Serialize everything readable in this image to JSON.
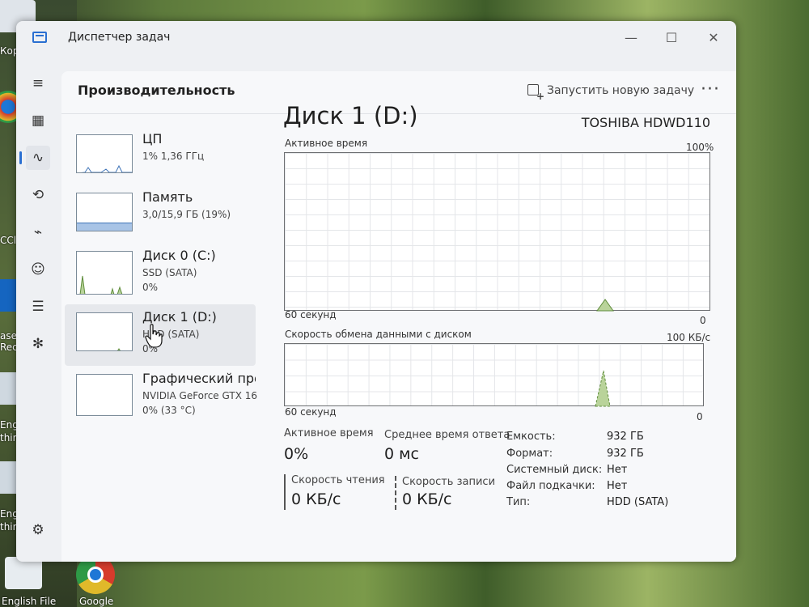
{
  "desktop": {
    "icons": [
      {
        "label": "Кор"
      },
      {
        "label": "CCl"
      },
      {
        "label": "asel"
      },
      {
        "label": "Reco"
      },
      {
        "label": "Engli"
      },
      {
        "label": "third"
      },
      {
        "label": "Engli"
      },
      {
        "label": "third"
      },
      {
        "label": "English File"
      },
      {
        "label": "Google"
      }
    ]
  },
  "window": {
    "title": "Диспетчер задач",
    "controls": {
      "minimize": "—",
      "maximize": "☐",
      "close": "✕"
    }
  },
  "nav": {
    "items": [
      {
        "icon": "hamburger-icon",
        "glyph": "≡"
      },
      {
        "icon": "processes-icon",
        "glyph": "▦"
      },
      {
        "icon": "performance-icon",
        "glyph": "∿"
      },
      {
        "icon": "history-icon",
        "glyph": "⟲"
      },
      {
        "icon": "startup-icon",
        "glyph": "⌁"
      },
      {
        "icon": "users-icon",
        "glyph": "☺"
      },
      {
        "icon": "details-icon",
        "glyph": "☰"
      },
      {
        "icon": "services-icon",
        "glyph": "✻"
      },
      {
        "icon": "settings-icon",
        "glyph": "⚙"
      }
    ]
  },
  "header": {
    "title": "Производительность",
    "run_task": "Запустить новую задачу",
    "more": "···"
  },
  "devices": [
    {
      "name": "ЦП",
      "sub1": "1% 1,36 ГГц",
      "sub2": ""
    },
    {
      "name": "Память",
      "sub1": "3,0/15,9 ГБ (19%)",
      "sub2": ""
    },
    {
      "name": "Диск 0 (C:)",
      "sub1": "SSD (SATA)",
      "sub2": "0%"
    },
    {
      "name": "Диск 1 (D:)",
      "sub1": "HDD (SATA)",
      "sub2": "0%"
    },
    {
      "name": "Графический про",
      "sub1": "NVIDIA GeForce GTX 16",
      "sub2": "0% (33 °C)"
    }
  ],
  "detail": {
    "title": "Диск 1 (D:)",
    "model": "TOSHIBA HDWD110",
    "active_time_graph": {
      "label": "Активное время",
      "max": "100%",
      "time": "60 секунд",
      "min": "0"
    },
    "transfer_graph": {
      "label": "Скорость обмена данными с диском",
      "max": "100 КБ/с",
      "time": "60 секунд",
      "min": "0"
    },
    "stats": {
      "active_time_label": "Активное время",
      "active_time_value": "0%",
      "avg_response_label": "Среднее время ответа",
      "avg_response_value": "0 мс",
      "read_label": "Скорость чтения",
      "read_value": "0 КБ/с",
      "write_label": "Скорость записи",
      "write_value": "0 КБ/с"
    },
    "properties": [
      {
        "key": "Емкость:",
        "value": "932 ГБ"
      },
      {
        "key": "Формат:",
        "value": "932 ГБ"
      },
      {
        "key": "Системный диск:",
        "value": "Нет"
      },
      {
        "key": "Файл подкачки:",
        "value": "Нет"
      },
      {
        "key": "Тип:",
        "value": "HDD (SATA)"
      }
    ]
  },
  "colors": {
    "accent": "#2a6fd1",
    "graph_border": "#6d6f72",
    "disk_fill": "#b9d39a",
    "disk_line": "#5f8d3c",
    "memory_fill": "#a8c4e6",
    "memory_line": "#3f74b8",
    "cpu_line": "#3f74b8"
  }
}
